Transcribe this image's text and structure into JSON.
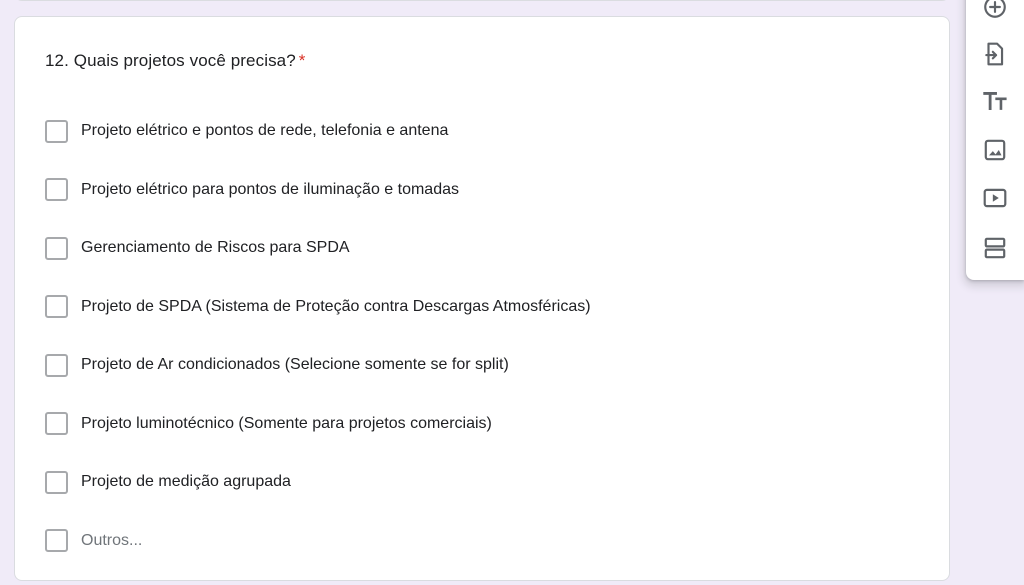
{
  "question": {
    "title": "12. Quais projetos você precisa?",
    "required_mark": "*",
    "options": [
      {
        "label": "Projeto elétrico e pontos de rede, telefonia e antena"
      },
      {
        "label": "Projeto elétrico para pontos de iluminação e tomadas"
      },
      {
        "label": "Gerenciamento de Riscos para SPDA"
      },
      {
        "label": "Projeto de SPDA (Sistema de Proteção contra Descargas Atmosféricas)"
      },
      {
        "label": "Projeto de Ar condicionados (Selecione somente se for split)"
      },
      {
        "label": "Projeto luminotécnico (Somente para projetos comerciais)"
      },
      {
        "label": "Projeto de medição agrupada"
      }
    ],
    "other_option": "Outros..."
  },
  "toolbar": {
    "tools": [
      "add-question-icon",
      "import-questions-icon",
      "add-title-icon",
      "add-image-icon",
      "add-video-icon",
      "add-section-icon"
    ]
  },
  "colors": {
    "background": "#f0ebf8",
    "card": "#ffffff",
    "required": "#d93025",
    "icon": "#5f6368"
  }
}
